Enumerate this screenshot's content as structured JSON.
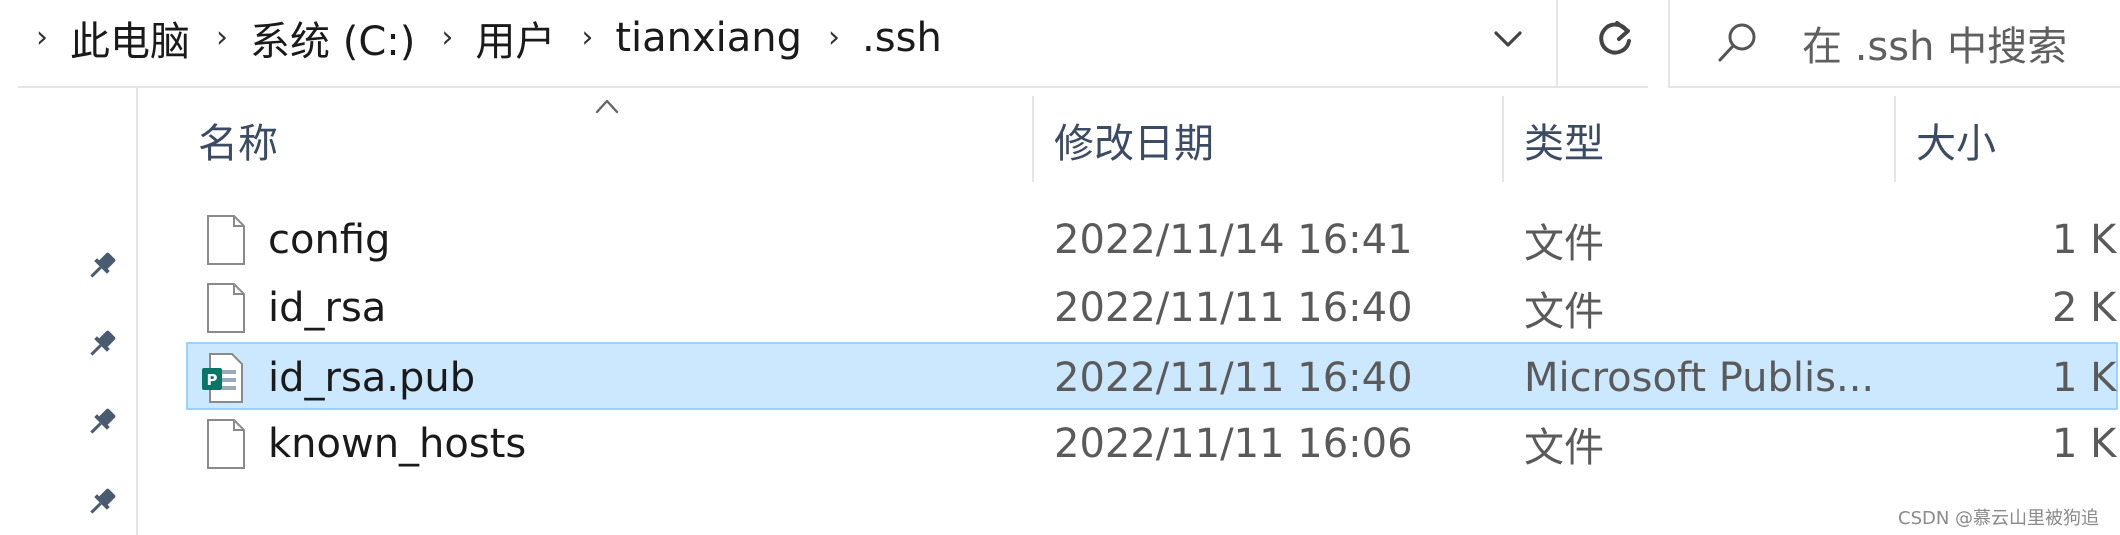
{
  "breadcrumb": {
    "items": [
      "此电脑",
      "系统 (C:)",
      "用户",
      "tianxiang",
      ".ssh"
    ]
  },
  "search": {
    "placeholder": "在 .ssh 中搜索"
  },
  "columns": {
    "name": "名称",
    "date": "修改日期",
    "type": "类型",
    "size": "大小"
  },
  "files": [
    {
      "name": "config",
      "date": "2022/11/14 16:41",
      "type": "文件",
      "size": "1 K",
      "icon": "blank-file-icon",
      "selected": false
    },
    {
      "name": "id_rsa",
      "date": "2022/11/11 16:40",
      "type": "文件",
      "size": "2 K",
      "icon": "blank-file-icon",
      "selected": false
    },
    {
      "name": "id_rsa.pub",
      "date": "2022/11/11 16:40",
      "type": "Microsoft Publis...",
      "size": "1 K",
      "icon": "publisher-file-icon",
      "selected": true
    },
    {
      "name": "known_hosts",
      "date": "2022/11/11 16:06",
      "type": "文件",
      "size": "1 K",
      "icon": "blank-file-icon",
      "selected": false
    }
  ],
  "watermark": "CSDN @慕云山里被狗追",
  "colors": {
    "selection_bg": "#cce8ff",
    "selection_border": "#99d1ff",
    "publisher_green": "#077568"
  }
}
